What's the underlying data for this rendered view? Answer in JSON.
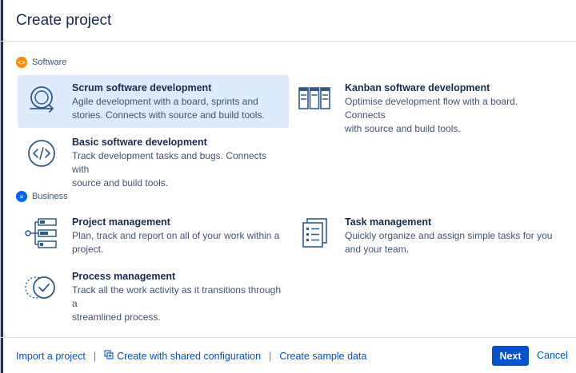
{
  "dialog": {
    "title": "Create project"
  },
  "categories": {
    "software": {
      "label": "Software",
      "icon": "code-brackets-icon",
      "color": "#FF8B00"
    },
    "business": {
      "label": "Business",
      "icon": "document-lines-icon",
      "color": "#0065FF"
    }
  },
  "options": {
    "scrum": {
      "title": "Scrum software development",
      "desc_line1": "Agile development with a board, sprints and",
      "desc_line2": "stories. Connects with source and build tools.",
      "icon": "scrum-cycle-icon",
      "selected": true
    },
    "kanban": {
      "title": "Kanban software development",
      "desc_line1": "Optimise development flow with a board. Connects",
      "desc_line2": "with source and build tools.",
      "icon": "kanban-board-icon"
    },
    "basic": {
      "title": "Basic software development",
      "desc_line1": "Track development tasks and bugs. Connects with",
      "desc_line2": "source and build tools.",
      "icon": "code-circle-icon"
    },
    "project_mgmt": {
      "title": "Project management",
      "desc_line1": "Plan, track and report on all of your work within a",
      "desc_line2": "project.",
      "icon": "project-tree-icon"
    },
    "task_mgmt": {
      "title": "Task management",
      "desc_line1": "Quickly organize and assign simple tasks for you",
      "desc_line2": "and your team.",
      "icon": "task-list-icon"
    },
    "process_mgmt": {
      "title": "Process management",
      "desc_line1": "Track all the work activity as it transitions through a",
      "desc_line2": "streamlined process.",
      "icon": "process-check-icon"
    }
  },
  "footer": {
    "import_label": "Import a project",
    "shared_config_label": "Create with shared configuration",
    "sample_data_label": "Create sample data",
    "separator": "|",
    "next_label": "Next",
    "cancel_label": "Cancel"
  },
  "colors": {
    "primary": "#0052CC",
    "selected_bg": "#DEEBFF",
    "text": "#172B4D",
    "subtext": "#42526E",
    "icon_blue": "#2F5A8C"
  }
}
